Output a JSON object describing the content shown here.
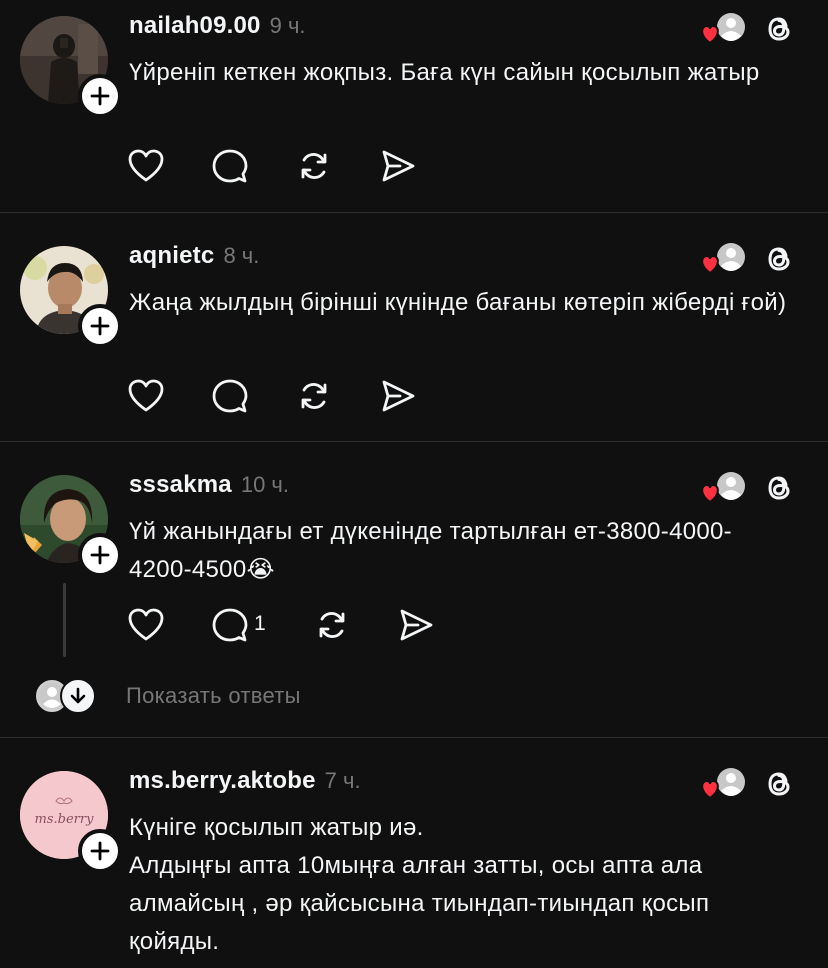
{
  "posts": [
    {
      "username": "nailah09.00",
      "time": "9 ч.",
      "text": "Үйреніп кеткен жоқпыз. Баға күн сайын қосылып жатыр",
      "reply_count": ""
    },
    {
      "username": "aqnietc",
      "time": "8 ч.",
      "text": "Жаңа жылдың бірінші күнінде бағаны көтеріп жіберді ғой)",
      "reply_count": ""
    },
    {
      "username": "sssakma",
      "time": "10 ч.",
      "text": "Үй жанындағы ет дүкенінде тартылған ет-3800-4000-4200-4500😭",
      "reply_count": "1"
    },
    {
      "username": "ms.berry.aktobe",
      "time": "7 ч.",
      "text_line1": "Күніге қосылып жатыр иә.",
      "text_line2": "Алдыңғы апта 10мыңға алған затты, осы апта ала алмайсың , әр қайсысына тиындап-тиындап қосып қойяды.",
      "avatar_logo": "ms.berry"
    }
  ],
  "show_replies_label": "Показать ответы",
  "icons": {
    "like": "heart-icon",
    "comment": "comment-icon",
    "repost": "repost-icon",
    "share": "send-icon",
    "threads": "threads-logo-icon",
    "follow": "plus-icon"
  },
  "colors": {
    "background": "#101010",
    "text": "#f3f5f7",
    "muted": "#777777",
    "heart": "#ff3040"
  }
}
